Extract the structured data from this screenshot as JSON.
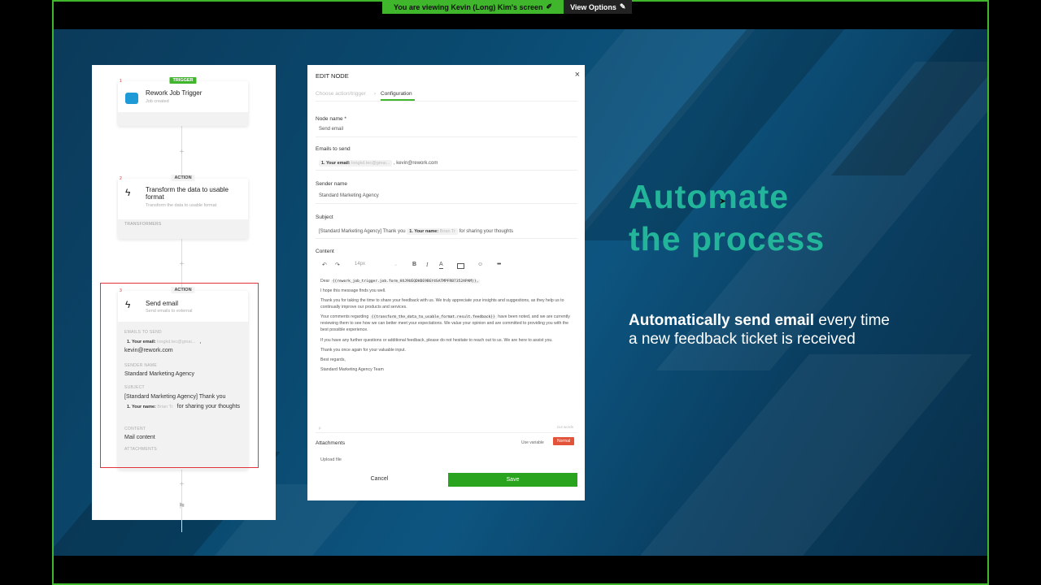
{
  "share_banner": {
    "viewing_text": "You are viewing  Kevin (Long) Kim's screen",
    "view_options": "View Options"
  },
  "workflow": {
    "trigger": {
      "badge": "TRIGGER",
      "number": "1",
      "title": "Rework Job Trigger",
      "subtitle": "Job created"
    },
    "action1": {
      "badge": "ACTION",
      "number": "2",
      "title": "Transform the data to usable format",
      "subtitle": "Transform the data to usable format",
      "footer": "TRANSFORMERS"
    },
    "action2": {
      "badge": "ACTION",
      "number": "3",
      "title": "Send email",
      "subtitle": "Send emails to external",
      "emails_label": "EMAILS TO SEND",
      "your_email": "1. Your email:",
      "your_email_ph": "longkd.tec@gmai...",
      "emails_rest": "kevin@rework.com",
      "sender_label": "SENDER NAME",
      "sender_value": "Standard Marketing Agency",
      "subject_label": "SUBJECT",
      "subject_pre": "[Standard Marketing Agency] Thank you",
      "your_name": "1. Your name:",
      "your_name_ph": "Brian Tr",
      "subject_post": "for sharing your thoughts",
      "content_label": "CONTENT",
      "content_value": "Mail content",
      "attachments_label": "ATTACHMENTS"
    }
  },
  "dialog": {
    "title": "EDIT NODE",
    "tab_choose": "Choose action/trigger",
    "tab_config": "Configuration",
    "node_name_label": "Node name *",
    "node_name": "Send email",
    "emails_label": "Emails to send",
    "email_chip": "1. Your email:",
    "email_chip_ph": "longkd.tec@gmai...",
    "email_extra": ", kevin@rework.com",
    "sender_label": "Sender name",
    "sender": "Standard Marketing Agency",
    "subject_label": "Subject",
    "subject_pre": "[Standard Marketing Agency] Thank you",
    "subject_chip": "1. Your name:",
    "subject_chip_ph": "Brian Tr",
    "subject_post": "for sharing your thoughts",
    "content_label": "Content",
    "font_size": "14px",
    "content": {
      "dear": "Dear",
      "var1": "{{rework_job_trigger.job.form_HXJ9UEQDHDE9BGY4SATMPFRB7352APAM}},",
      "p1": "I hope this message finds you well.",
      "p2": "Thank you for taking the time to share your feedback with us. We truly appreciate your insights and suggestions, as they help us to continually improve our products and services.",
      "p3_pre": "Your comments regarding",
      "var2": "{{transform_the_data_to_usable_format.result.feedback}}",
      "p3_post": "have been noted, and we are currently reviewing them to see how we can better meet your expectations. We value your opinion and are committed to providing you with the best possible experience.",
      "p4": "If you have any further questions or additional feedback, please do not hesitate to reach out to us. We are here to assist you.",
      "p5": "Thank you once again for your valuable input.",
      "p6": "Best regards,",
      "p7": "Standard Marketing Agency Team",
      "word_count": "114 words",
      "p_marker": "p"
    },
    "attachments_label": "Attachments",
    "use_variable": "Use variable",
    "normal": "Normal",
    "upload": "Upload file",
    "cancel": "Cancel",
    "save": "Save"
  },
  "slide": {
    "heading_line1": "Automate",
    "heading_line2": "the process",
    "sub_bold": "Automatically send email",
    "sub_rest1": "every time",
    "sub_rest2": "a new feedback ticket is received"
  },
  "colors": {
    "accent_green": "#3fb62b",
    "heading_teal": "#22b59a",
    "highlight_red": "#e2333a",
    "save_green": "#2aa31e"
  }
}
